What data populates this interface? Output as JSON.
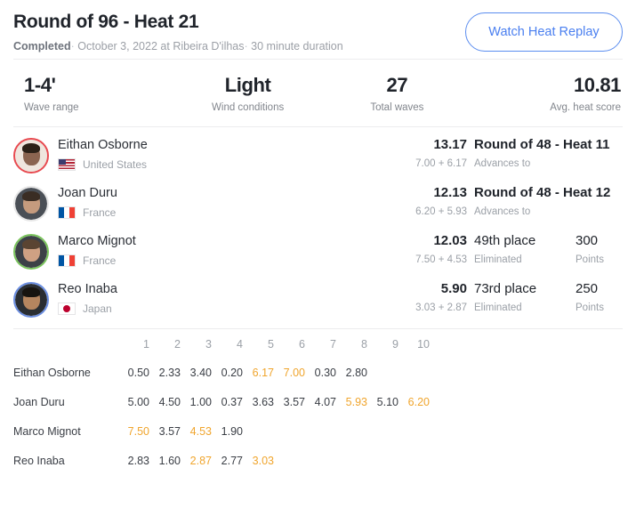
{
  "header": {
    "title": "Round of 96 - Heat 21",
    "status": "Completed",
    "date": "October 3, 2022",
    "location_prefix": "at",
    "location": "Ribeira D'ilhas",
    "duration": "30 minute duration",
    "separator": "·",
    "replay_button": "Watch Heat Replay"
  },
  "stats": [
    {
      "value": "1-4'",
      "label": "Wave range"
    },
    {
      "value": "Light",
      "label": "Wind conditions"
    },
    {
      "value": "27",
      "label": "Total waves"
    },
    {
      "value": "10.81",
      "label": "Avg. heat score"
    }
  ],
  "athletes": [
    {
      "name": "Eithan Osborne",
      "country": "United States",
      "flag": "us-flag",
      "jersey_color": "#e8494f",
      "skin": "#8a6450",
      "hair": "#2b2118",
      "shirt": "#efe6de",
      "total": "13.17",
      "waves_sum": "7.00 + 6.17",
      "result_main": "Round of 48 - Heat 11",
      "result_main_strong": true,
      "result_sub": "Advances to",
      "points_main": "",
      "points_sub": ""
    },
    {
      "name": "Joan Duru",
      "country": "France",
      "flag": "fr-flag",
      "jersey_color": "#e7e7e7",
      "skin": "#c59b7e",
      "hair": "#3a2d24",
      "shirt": "#4a4f56",
      "total": "12.13",
      "waves_sum": "6.20 + 5.93",
      "result_main": "Round of 48 - Heat 12",
      "result_main_strong": true,
      "result_sub": "Advances to",
      "points_main": "",
      "points_sub": ""
    },
    {
      "name": "Marco Mignot",
      "country": "France",
      "flag": "fr-flag",
      "jersey_color": "#7ac45c",
      "skin": "#cfa183",
      "hair": "#5a4432",
      "shirt": "#3c4147",
      "total": "12.03",
      "waves_sum": "7.50 + 4.53",
      "result_main": "49th place",
      "result_main_strong": false,
      "result_sub": "Eliminated",
      "points_main": "300",
      "points_sub": "Points"
    },
    {
      "name": "Reo Inaba",
      "country": "Japan",
      "flag": "jp-flag",
      "jersey_color": "#6a8de0",
      "skin": "#b5855f",
      "hair": "#17130f",
      "shirt": "#2a2e33",
      "total": "5.90",
      "waves_sum": "3.03 + 2.87",
      "result_main": "73rd place",
      "result_main_strong": false,
      "result_sub": "Eliminated",
      "points_main": "250",
      "points_sub": "Points"
    }
  ],
  "wave_table": {
    "columns": [
      "1",
      "2",
      "3",
      "4",
      "5",
      "6",
      "7",
      "8",
      "9",
      "10"
    ],
    "counted_color": "#f0a52d",
    "rows": [
      {
        "name": "Eithan Osborne",
        "scores": [
          "0.50",
          "2.33",
          "3.40",
          "0.20",
          "6.17",
          "7.00",
          "0.30",
          "2.80",
          "",
          ""
        ],
        "counted": [
          false,
          false,
          false,
          false,
          true,
          true,
          false,
          false,
          false,
          false
        ]
      },
      {
        "name": "Joan Duru",
        "scores": [
          "5.00",
          "4.50",
          "1.00",
          "0.37",
          "3.63",
          "3.57",
          "4.07",
          "5.93",
          "5.10",
          "6.20"
        ],
        "counted": [
          false,
          false,
          false,
          false,
          false,
          false,
          false,
          true,
          false,
          true
        ]
      },
      {
        "name": "Marco Mignot",
        "scores": [
          "7.50",
          "3.57",
          "4.53",
          "1.90",
          "",
          "",
          "",
          "",
          "",
          ""
        ],
        "counted": [
          true,
          false,
          true,
          false,
          false,
          false,
          false,
          false,
          false,
          false
        ]
      },
      {
        "name": "Reo Inaba",
        "scores": [
          "2.83",
          "1.60",
          "2.87",
          "2.77",
          "3.03",
          "",
          "",
          "",
          "",
          ""
        ],
        "counted": [
          false,
          false,
          true,
          false,
          true,
          false,
          false,
          false,
          false,
          false
        ]
      }
    ]
  }
}
